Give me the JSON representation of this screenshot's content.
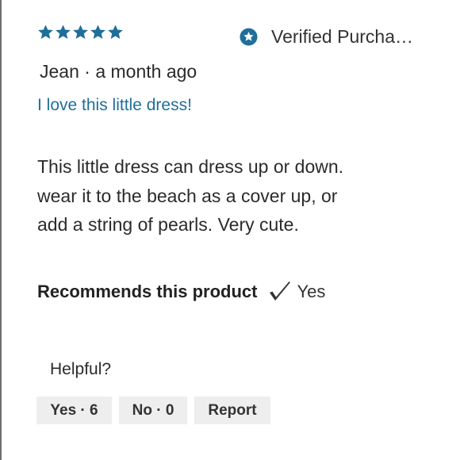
{
  "review": {
    "rating": 5,
    "rating_max": 5,
    "star_color": "#1f6f9a",
    "verified_label": "Verified Purcha…",
    "verified_icon": "star-badge-icon",
    "author": "Jean",
    "separator": "·",
    "posted": "a month ago",
    "title": "I love this little dress!",
    "body_lines": [
      "This little dress can dress up or down.",
      "wear it to the beach as a cover up, or",
      "add a string of pearls. Very cute."
    ],
    "recommends_label": "Recommends this product",
    "recommends_icon": "checkmark-icon",
    "recommends_value": "Yes"
  },
  "feedback": {
    "prompt": "Helpful?",
    "yes_label": "Yes · 6",
    "no_label": "No · 0",
    "report_label": "Report",
    "button_bg": "#eeeeee"
  }
}
